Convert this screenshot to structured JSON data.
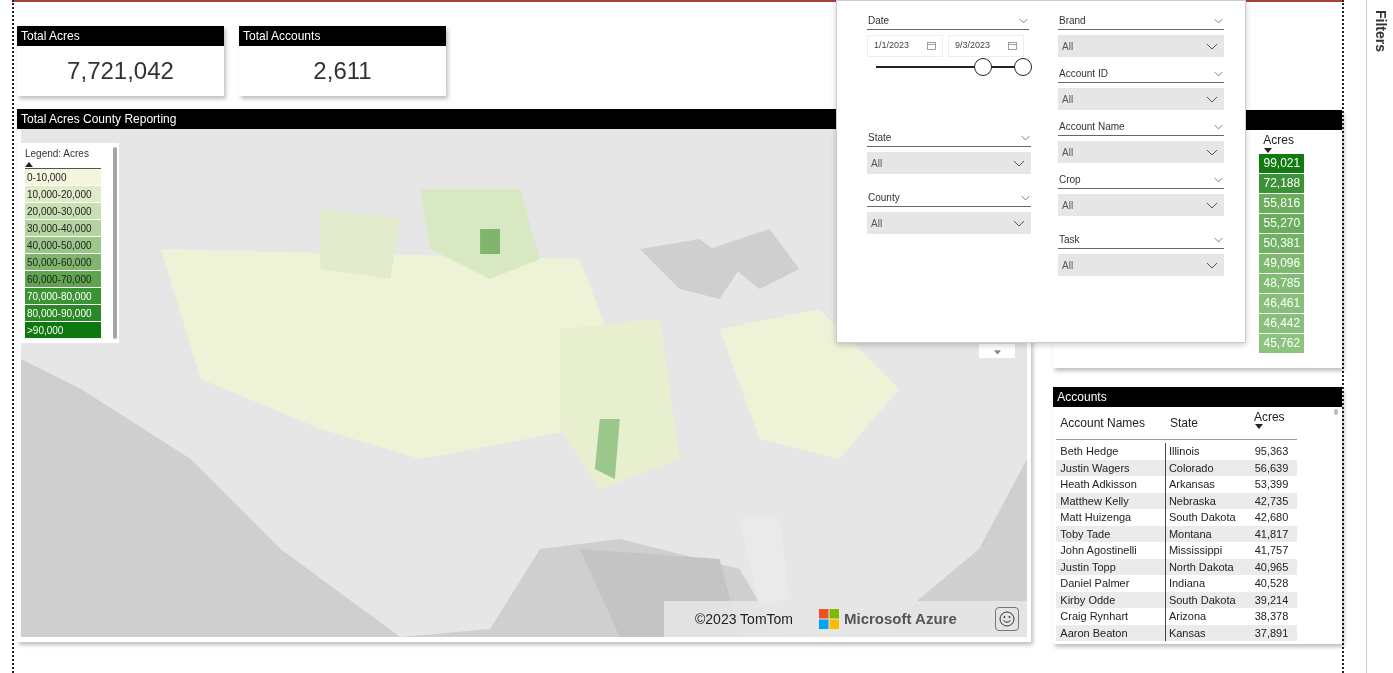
{
  "cards": [
    {
      "title": "Total Acres",
      "value": "7,721,042"
    },
    {
      "title": "Total Accounts",
      "value": "2,611"
    }
  ],
  "map": {
    "title": "Total Acres County Reporting",
    "legend": {
      "title": "Legend: Acres",
      "items": [
        {
          "label": "0-10,000",
          "color": "#f3f6dc"
        },
        {
          "label": "10,000-20,000",
          "color": "#dfecca"
        },
        {
          "label": "20,000-30,000",
          "color": "#c8e0b4"
        },
        {
          "label": "30,000-40,000",
          "color": "#b3d49e"
        },
        {
          "label": "40,000-50,000",
          "color": "#9cc78a"
        },
        {
          "label": "50,000-60,000",
          "color": "#7fb56c"
        },
        {
          "label": "60,000-70,000",
          "color": "#5fa550"
        },
        {
          "label": "70,000-80,000",
          "color": "#3c9335"
        },
        {
          "label": "80,000-90,000",
          "color": "#2a8826"
        },
        {
          "label": ">90,000",
          "color": "#0d780d"
        }
      ]
    },
    "attribution": {
      "copyright": "©2023 TomTom",
      "brand": "Microsoft Azure"
    }
  },
  "top_table": {
    "column": "Acres",
    "rows": [
      {
        "value": "99,021",
        "color": "#107c10"
      },
      {
        "value": "72,188",
        "color": "#3d9237"
      },
      {
        "value": "55,816",
        "color": "#6aad5d"
      },
      {
        "value": "55,270",
        "color": "#6aad5d"
      },
      {
        "value": "50,381",
        "color": "#72b265"
      },
      {
        "value": "49,096",
        "color": "#7fb971"
      },
      {
        "value": "48,785",
        "color": "#82bb74"
      },
      {
        "value": "46,461",
        "color": "#88bf7a"
      },
      {
        "value": "46,442",
        "color": "#88bf7a"
      },
      {
        "value": "45,762",
        "color": "#8ec27f"
      }
    ]
  },
  "accounts": {
    "title": "Accounts",
    "columns": [
      "Account Names",
      "State",
      "Acres"
    ],
    "rows": [
      [
        "Beth Hedge",
        "Illinois",
        "95,363"
      ],
      [
        "Justin Wagers",
        "Colorado",
        "56,639"
      ],
      [
        "Heath Adkisson",
        "Arkansas",
        "53,399"
      ],
      [
        "Matthew Kelly",
        "Nebraska",
        "42,735"
      ],
      [
        "Matt Huizenga",
        "South Dakota",
        "42,680"
      ],
      [
        "Toby Tade",
        "Montana",
        "41,817"
      ],
      [
        "John Agostinelli",
        "Mississippi",
        "41,757"
      ],
      [
        "Justin Topp",
        "North Dakota",
        "40,965"
      ],
      [
        "Daniel Palmer",
        "Indiana",
        "40,528"
      ],
      [
        "Kirby Odde",
        "South Dakota",
        "39,214"
      ],
      [
        "Craig Rynhart",
        "Arizona",
        "38,378"
      ],
      [
        "Aaron Beaton",
        "Kansas",
        "37,891"
      ]
    ]
  },
  "filter_panel": {
    "columns": [
      [
        {
          "kind": "date_range",
          "label": "Date",
          "start": "1/1/2023",
          "end": "9/3/2023",
          "thumbs": [
            {
              "level": 0.73
            },
            {
              "level": 1
            }
          ]
        },
        {
          "kind": "dropdown",
          "label": "State",
          "value": "All"
        },
        {
          "kind": "dropdown",
          "label": "County",
          "value": "All"
        }
      ],
      [
        {
          "kind": "dropdown",
          "label": "Brand",
          "value": "All"
        },
        {
          "kind": "dropdown",
          "label": "Account ID",
          "value": "All"
        },
        {
          "kind": "dropdown",
          "label": "Account Name",
          "value": "All"
        },
        {
          "kind": "dropdown",
          "label": "Crop",
          "value": "All"
        },
        {
          "kind": "dropdown",
          "label": "Task",
          "value": "All"
        }
      ]
    ]
  },
  "filters_pane": {
    "label": "Filters"
  }
}
